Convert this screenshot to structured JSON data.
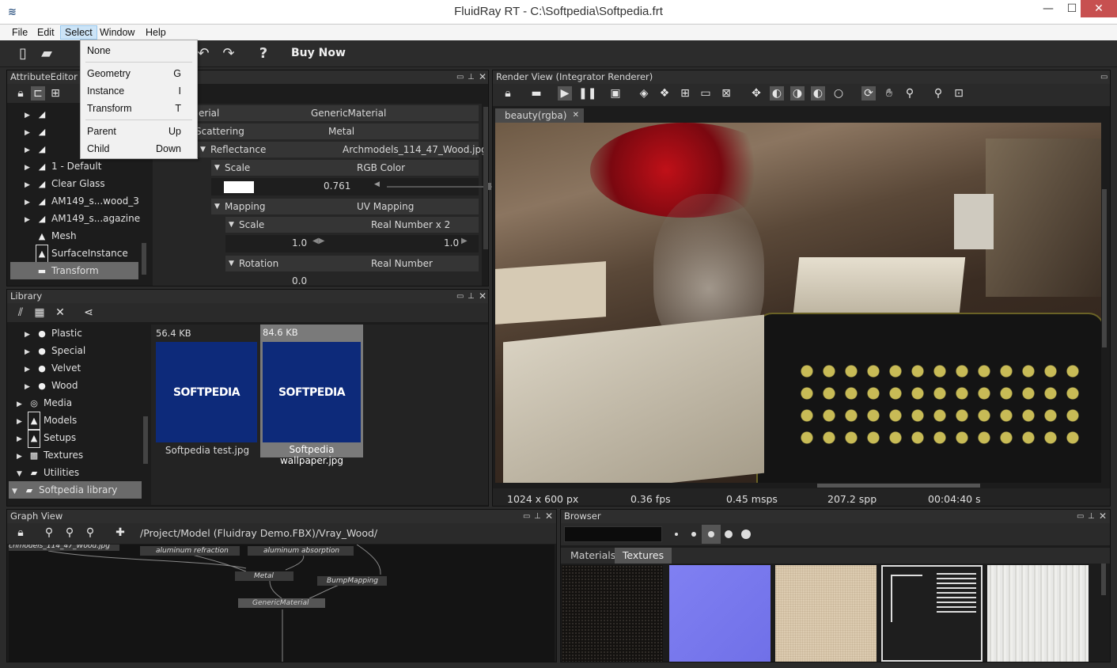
{
  "window": {
    "title": "FluidRay RT - C:\\Softpedia\\Softpedia.frt"
  },
  "menu": {
    "items": [
      "File",
      "Edit",
      "Select",
      "Window",
      "Help"
    ],
    "active": "Select"
  },
  "toolbar": {
    "buy_now": "Buy Now",
    "help_glyph": "?"
  },
  "select_menu": {
    "items": [
      {
        "label": "None",
        "shortcut": ""
      },
      {
        "label": "Geometry",
        "shortcut": "G"
      },
      {
        "label": "Instance",
        "shortcut": "I"
      },
      {
        "label": "Transform",
        "shortcut": "T"
      },
      {
        "label": "Parent",
        "shortcut": "Up"
      },
      {
        "label": "Child",
        "shortcut": "Down"
      }
    ]
  },
  "attribute_editor": {
    "title": "AttributeEditor",
    "tree": [
      "1 - Default",
      "Clear Glass",
      "AM149_s...wood_3",
      "AM149_s...agazine",
      "Mesh",
      "SurfaceInstance",
      "Transform"
    ],
    "props": {
      "material_label": "erial",
      "material_value": "GenericMaterial",
      "scattering_label": "Scattering",
      "scattering_value": "Metal",
      "reflectance_label": "Reflectance",
      "reflectance_value": "Archmodels_114_47_Wood.jpg",
      "scale_label": "Scale",
      "scale_value": "RGB Color",
      "scale_number": "0.761",
      "mapping_label": "Mapping",
      "mapping_value": "UV Mapping",
      "scale2_label": "Scale",
      "scale2_value": "Real Number x 2",
      "scale2_a": "1.0",
      "scale2_b": "1.0",
      "rotation_label": "Rotation",
      "rotation_value": "Real Number",
      "rotation_number": "0.0"
    }
  },
  "library": {
    "title": "Library",
    "tree": [
      "Plastic",
      "Special",
      "Velvet",
      "Wood",
      "Media",
      "Models",
      "Setups",
      "Textures",
      "Utilities",
      "Softpedia library"
    ],
    "files": [
      {
        "size": "56.4 KB",
        "name": "Softpedia test.jpg",
        "logo": "SOFTPEDIA"
      },
      {
        "size": "84.6 KB",
        "name": "Softpedia wallpaper.jpg",
        "logo": "SOFTPEDIA"
      }
    ]
  },
  "render_view": {
    "title": "Render View (Integrator Renderer)",
    "tab": "beauty(rgba)",
    "stats": [
      "1024 x 600 px",
      "0.36 fps",
      "0.45 msps",
      "207.2 spp",
      "00:04:40 s"
    ]
  },
  "graph_view": {
    "title": "Graph View",
    "path": "/Project/Model (Fluidray Demo.FBX)/Vray_Wood/",
    "nodes": [
      "aluminum refraction",
      "aluminum absorption",
      "Metal",
      "BumpMapping",
      "GenericMaterial",
      "chmodels_114_47_Wood.jpg"
    ]
  },
  "browser": {
    "title": "Browser",
    "tabs": [
      "Materials",
      "Textures"
    ],
    "active_tab": "Textures"
  },
  "colors": {
    "accent": "#0d2a7a",
    "panel": "#1c1c1c",
    "title": "#2e2e2e"
  }
}
